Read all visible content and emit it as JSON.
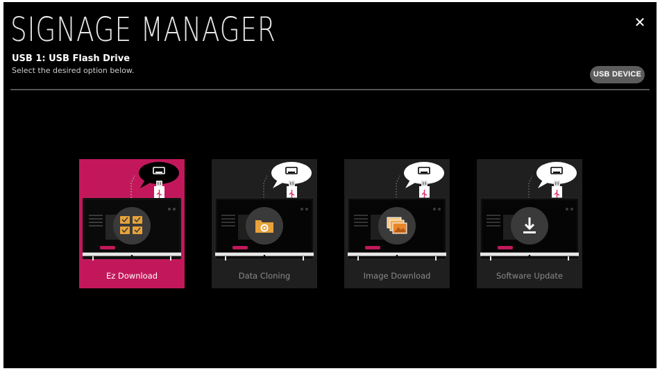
{
  "header": {
    "title": "SIGNAGE MANAGER",
    "subtitle": "USB 1: USB Flash Drive",
    "description": "Select the desired option below.",
    "usb_button": "USB DEVICE",
    "close_icon": "✕"
  },
  "options": [
    {
      "label": "Ez Download",
      "icon": "checklist-icon",
      "selected": true
    },
    {
      "label": "Data Cloning",
      "icon": "folder-gear-icon",
      "selected": false
    },
    {
      "label": "Image Download",
      "icon": "images-stack-icon",
      "selected": false
    },
    {
      "label": "Software Update",
      "icon": "download-arrow-icon",
      "selected": false
    }
  ],
  "colors": {
    "background": "#000000",
    "accent": "#c2185b",
    "usb_pink": "#e0245e",
    "icon_orange": "#e8a23a"
  }
}
